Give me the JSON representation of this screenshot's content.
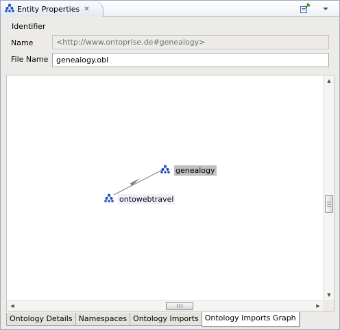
{
  "view": {
    "title": "Entity Properties",
    "close_glyph": "✕",
    "icons": {
      "view_icon": "ontology-icon",
      "toolbar_icon": "pin-icon"
    }
  },
  "identifier": {
    "section_title": "Identifier",
    "name_label": "Name",
    "name_value": "<http://www.ontoprise.de#genealogy>",
    "file_label": "File Name",
    "file_value": "genealogy.obl"
  },
  "graph": {
    "nodes": [
      {
        "id": "genealogy",
        "label": "genealogy",
        "selected": true
      },
      {
        "id": "ontowebtravel",
        "label": "ontowebtravel",
        "selected": false
      }
    ],
    "edges": [
      {
        "from": "ontowebtravel",
        "to": "genealogy"
      }
    ],
    "node_icon": "ontology-icon",
    "edge_color": "#7b7b7b"
  },
  "scrollbars": {
    "up": "▲",
    "down": "▼",
    "left": "◀",
    "right": "▶"
  },
  "tabs": [
    {
      "label": "Ontology Details",
      "active": false
    },
    {
      "label": "Namespaces",
      "active": false
    },
    {
      "label": "Ontology Imports",
      "active": false
    },
    {
      "label": "Ontology Imports Graph",
      "active": true
    }
  ],
  "colors": {
    "accent": "#1f4fbf",
    "selected_label_bg": "#c0c0c0"
  }
}
